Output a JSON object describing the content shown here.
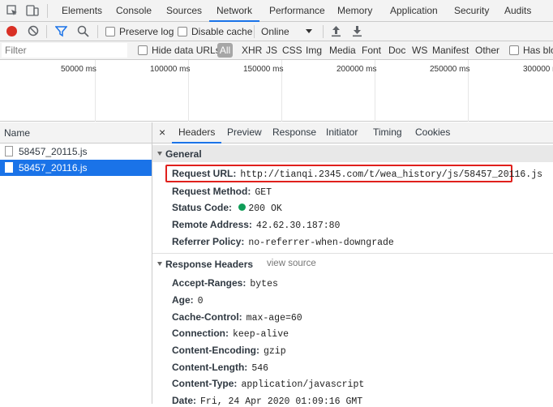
{
  "tabs": {
    "elements": "Elements",
    "console": "Console",
    "sources": "Sources",
    "network": "Network",
    "performance": "Performance",
    "memory": "Memory",
    "application": "Application",
    "security": "Security",
    "audits": "Audits"
  },
  "toolbar": {
    "preserve_log": "Preserve log",
    "disable_cache": "Disable cache",
    "throttle": "Online"
  },
  "filter": {
    "placeholder": "Filter",
    "hide_data_urls": "Hide data URLs",
    "types": [
      "All",
      "XHR",
      "JS",
      "CSS",
      "Img",
      "Media",
      "Font",
      "Doc",
      "WS",
      "Manifest",
      "Other"
    ],
    "has_blocked": "Has blo"
  },
  "timeline": {
    "ticks": [
      "50000 ms",
      "100000 ms",
      "150000 ms",
      "200000 ms",
      "250000 ms",
      "300000 r"
    ]
  },
  "requests": {
    "header": "Name",
    "items": [
      "58457_20115.js",
      "58457_20116.js"
    ]
  },
  "details": {
    "close": "×",
    "tabs": [
      "Headers",
      "Preview",
      "Response",
      "Initiator",
      "Timing",
      "Cookies"
    ],
    "general": {
      "title": "General",
      "request_url_label": "Request URL:",
      "request_url": "http://tianqi.2345.com/t/wea_history/js/58457_20116.js",
      "request_method_label": "Request Method:",
      "request_method": "GET",
      "status_code_label": "Status Code:",
      "status_code": "200 OK",
      "remote_address_label": "Remote Address:",
      "remote_address": "42.62.30.187:80",
      "referrer_policy_label": "Referrer Policy:",
      "referrer_policy": "no-referrer-when-downgrade"
    },
    "response_headers": {
      "title": "Response Headers",
      "view_source": "view source",
      "items": [
        {
          "name": "Accept-Ranges:",
          "value": "bytes"
        },
        {
          "name": "Age:",
          "value": "0"
        },
        {
          "name": "Cache-Control:",
          "value": "max-age=60"
        },
        {
          "name": "Connection:",
          "value": "keep-alive"
        },
        {
          "name": "Content-Encoding:",
          "value": "gzip"
        },
        {
          "name": "Content-Length:",
          "value": "546"
        },
        {
          "name": "Content-Type:",
          "value": "application/javascript"
        },
        {
          "name": "Date:",
          "value": "Fri, 24 Apr 2020 01:09:16 GMT"
        }
      ]
    }
  },
  "colors": {
    "accent": "#1a73e8",
    "record": "#d93025",
    "highlight": "#e0201c",
    "status_ok": "#0f9d58",
    "selected_row": "#1a73e8"
  }
}
